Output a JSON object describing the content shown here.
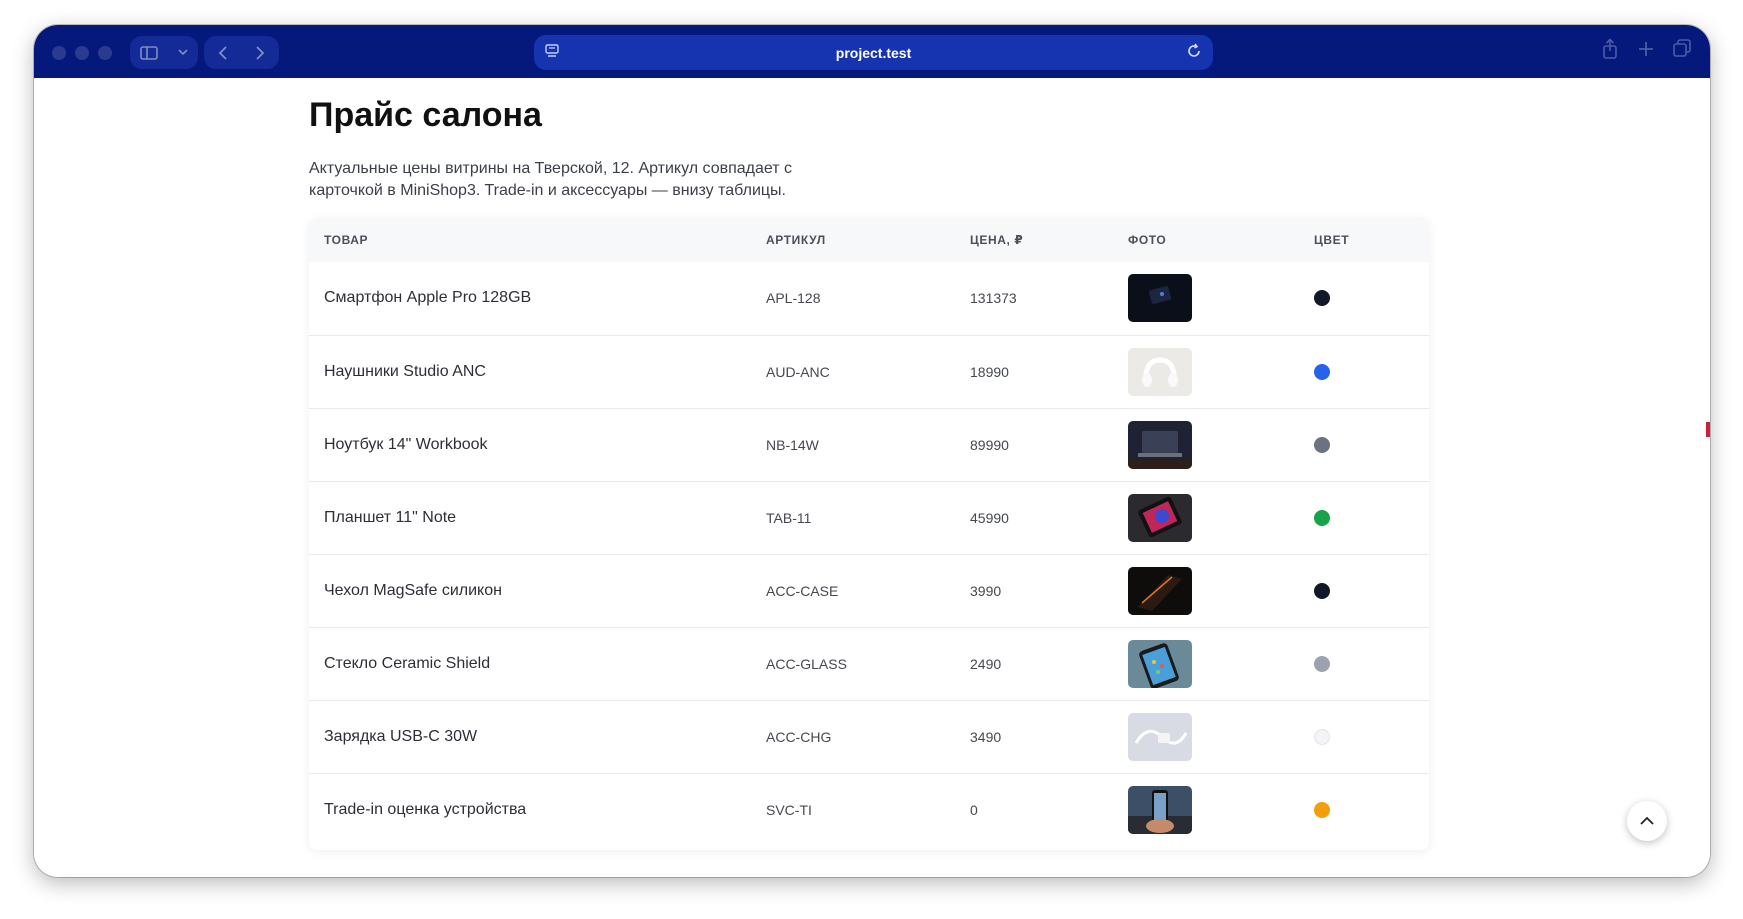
{
  "browser": {
    "url": "project.test",
    "traffic_lights": [
      "close",
      "minimize",
      "zoom"
    ]
  },
  "page": {
    "title": "Прайс салона",
    "description": "Актуальные цены витрины на Тверской, 12. Артикул совпадает с карточкой в MiniShop3. Trade-in и аксессуары — внизу таблицы."
  },
  "table": {
    "headers": [
      "ТОВАР",
      "АРТИКУЛ",
      "ЦЕНА, ₽",
      "ФОТО",
      "ЦВЕТ"
    ],
    "rows": [
      {
        "name": "Смартфон Apple Pro 128GB",
        "sku": "APL-128",
        "price": "131373",
        "photo": "phone-dark",
        "color": "#111827"
      },
      {
        "name": "Наушники Studio ANC",
        "sku": "AUD-ANC",
        "price": "18990",
        "photo": "headphones-white",
        "color": "#2563eb"
      },
      {
        "name": "Ноутбук 14\" Workbook",
        "sku": "NB-14W",
        "price": "89990",
        "photo": "laptop",
        "color": "#6b7280"
      },
      {
        "name": "Планшет 11\" Note",
        "sku": "TAB-11",
        "price": "45990",
        "photo": "tablet",
        "color": "#16a34a"
      },
      {
        "name": "Чехол MagSafe силикон",
        "sku": "ACC-CASE",
        "price": "3990",
        "photo": "case",
        "color": "#111827"
      },
      {
        "name": "Стекло Ceramic Shield",
        "sku": "ACC-GLASS",
        "price": "2490",
        "photo": "glass-phone",
        "color": "#9ca3af"
      },
      {
        "name": "Зарядка USB-C 30W",
        "sku": "ACC-CHG",
        "price": "3490",
        "photo": "charger",
        "color": "#f3f4f6"
      },
      {
        "name": "Trade-in оценка устройства",
        "sku": "SVC-TI",
        "price": "0",
        "photo": "hand-phone",
        "color": "#f59e0b"
      }
    ]
  },
  "icons": {
    "sidebar": "sidebar-icon",
    "chevron": "chevron-down-icon",
    "back": "back-icon",
    "forward": "forward-icon",
    "site": "site-settings-icon",
    "reload": "reload-icon",
    "share": "share-icon",
    "new_tab": "plus-icon",
    "tabs": "tabs-overview-icon",
    "scroll_top": "arrow-up-icon"
  },
  "colors": {
    "titlebar": "#05197d",
    "address_bar": "#1734b0"
  }
}
